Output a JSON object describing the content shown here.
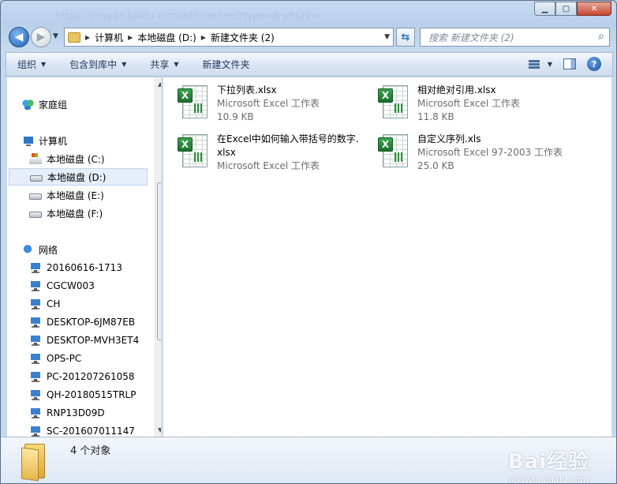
{
  "titlebar": {
    "faded_url": "https://jingyan.baidu.com/edit/content?type=draft&id="
  },
  "address": {
    "crumbs": [
      "计算机",
      "本地磁盘 (D:)",
      "新建文件夹 (2)"
    ]
  },
  "search": {
    "placeholder": "搜索 新建文件夹 (2)"
  },
  "commands": [
    "组织",
    "包含到库中",
    "共享",
    "新建文件夹"
  ],
  "nav": {
    "homegroup": "家庭组",
    "computer": "计算机",
    "drives": [
      "本地磁盘 (C:)",
      "本地磁盘 (D:)",
      "本地磁盘 (E:)",
      "本地磁盘 (F:)"
    ],
    "selected_drive": "本地磁盘 (D:)",
    "network": "网络",
    "hosts": [
      "20160616-1713",
      "CGCW003",
      "CH",
      "DESKTOP-6JM87EB",
      "DESKTOP-MVH3ET4",
      "OPS-PC",
      "PC-201207261058",
      "QH-20180515TRLP",
      "RNP13D09D",
      "SC-201607011147"
    ]
  },
  "files": [
    {
      "name": "下拉列表.xlsx",
      "kind": "Microsoft Excel 工作表",
      "size": "10.9 KB",
      "icon": "excel-xlsx-icon"
    },
    {
      "name": "相对绝对引用.xlsx",
      "kind": "Microsoft Excel 工作表",
      "size": "11.8 KB",
      "icon": "excel-xlsx-icon"
    },
    {
      "name_line1": "在Excel中如何输入带括号的数字.",
      "name_line2": "xlsx",
      "kind": "Microsoft Excel 工作表",
      "icon": "excel-xlsx-icon"
    },
    {
      "name": "自定义序列.xls",
      "kind": "Microsoft Excel 97-2003 工作表",
      "size": "25.0 KB",
      "icon": "excel-xls-icon"
    }
  ],
  "status": {
    "count": "4 个对象"
  },
  "watermark": {
    "brand": "Bai经验",
    "domain": "jingyan.baidu.com"
  }
}
